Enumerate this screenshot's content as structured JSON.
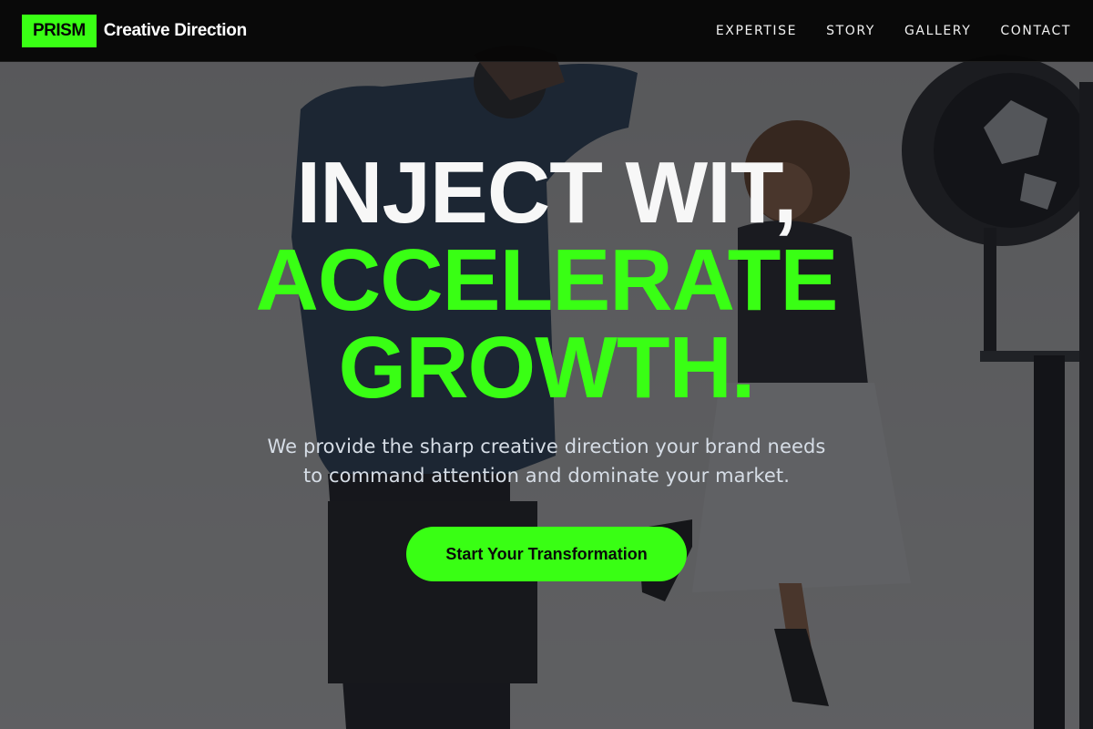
{
  "brand": {
    "logo": "PRISM",
    "name": "Creative Direction",
    "accent_color": "#39ff14"
  },
  "nav": {
    "items": [
      "EXPERTISE",
      "STORY",
      "GALLERY",
      "CONTACT"
    ]
  },
  "hero": {
    "headline_line1": "INJECT WIT,",
    "headline_line2": "ACCELERATE",
    "headline_line3": "GROWTH.",
    "subtitle_line1": "We provide the sharp creative direction your brand needs",
    "subtitle_line2": "to command attention and dominate your market.",
    "cta_label": "Start Your Transformation",
    "background_description": "photo-shoot-studio-image"
  }
}
